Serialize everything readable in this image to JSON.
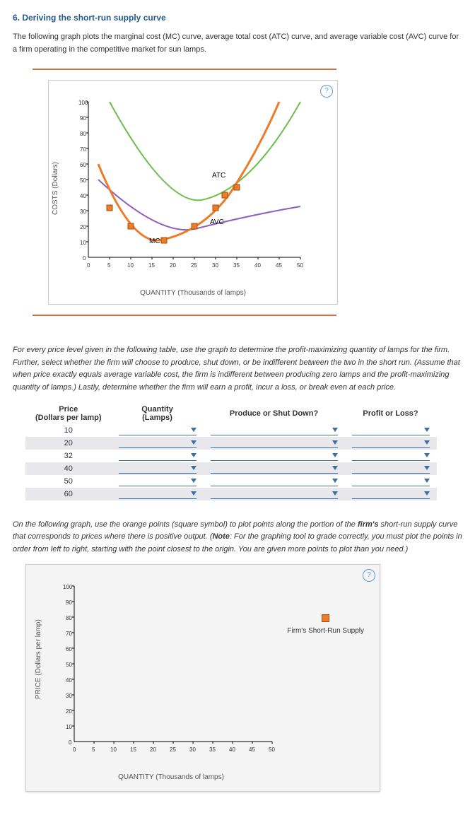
{
  "title": "6. Deriving the short-run supply curve",
  "intro": "The following graph plots the marginal cost (MC) curve, average total cost (ATC) curve, and average variable cost (AVC) curve for a firm operating in the competitive market for sun lamps.",
  "help": "?",
  "chart1": {
    "ylabel": "COSTS (Dollars)",
    "xlabel": "QUANTITY (Thousands of lamps)",
    "mc": "MC",
    "atc": "ATC",
    "avc": "AVC"
  },
  "instr2": "For every price level given in the following table, use the graph to determine the profit-maximizing quantity of lamps for the firm. Further, select whether the firm will choose to produce, shut down, or be indifferent between the two in the short run. (Assume that when price exactly equals average variable cost, the firm is indifferent between producing zero lamps and the profit-maximizing quantity of lamps.) Lastly, determine whether the firm will earn a profit, incur a loss, or break even at each price.",
  "table": {
    "h1a": "Price",
    "h1b": "(Dollars per lamp)",
    "h2a": "Quantity",
    "h2b": "(Lamps)",
    "h3": "Produce or Shut Down?",
    "h4": "Profit or Loss?",
    "prices": [
      "10",
      "20",
      "32",
      "40",
      "50",
      "60"
    ]
  },
  "instr3a": "On the following graph, use the orange points (square symbol) to plot points along the portion of the ",
  "instr3b": "firm's",
  "instr3c": " short-run supply curve that corresponds to prices where there is positive output. (",
  "instr3d": "Note",
  "instr3e": ": For the graphing tool to grade correctly, you must plot the points in order from left to right, starting with the point closest to the origin. You are given more points to plot than you need.)",
  "chart2": {
    "ylabel": "PRICE (Dollars per lamp)",
    "xlabel": "QUANTITY (Thousands of lamps)",
    "legend": "Firm's Short-Run Supply"
  },
  "chart_data": [
    {
      "type": "line",
      "title": "Cost curves",
      "xlabel": "QUANTITY (Thousands of lamps)",
      "ylabel": "COSTS (Dollars)",
      "xlim": [
        0,
        50
      ],
      "ylim": [
        0,
        100
      ],
      "xticks": [
        0,
        5,
        10,
        15,
        20,
        25,
        30,
        35,
        40,
        45,
        50
      ],
      "yticks": [
        0,
        10,
        20,
        30,
        40,
        50,
        60,
        70,
        80,
        90,
        100
      ],
      "series": [
        {
          "name": "MC",
          "color": "#ec7c2a",
          "x": [
            3,
            5,
            10,
            15,
            20,
            25,
            30,
            35,
            40,
            45
          ],
          "y": [
            60,
            32,
            20,
            12,
            14,
            20,
            32,
            45,
            60,
            100
          ]
        },
        {
          "name": "ATC",
          "color": "#6cbf4b",
          "x": [
            5,
            10,
            15,
            20,
            25,
            30,
            35,
            40,
            45,
            50
          ],
          "y": [
            100,
            65,
            48,
            40,
            37,
            40,
            47,
            55,
            72,
            100
          ]
        },
        {
          "name": "AVC",
          "color": "#8e5fbf",
          "x": [
            3,
            10,
            15,
            20,
            25,
            30,
            35,
            40,
            45,
            50
          ],
          "y": [
            50,
            30,
            22,
            18,
            18,
            20,
            25,
            30,
            32,
            33
          ]
        }
      ],
      "markers": {
        "name": "MC points",
        "color": "#ec7c2a",
        "shape": "square",
        "x": [
          5,
          10,
          25,
          30,
          32,
          35
        ],
        "y": [
          32,
          20,
          20,
          32,
          40,
          45
        ]
      }
    },
    {
      "type": "scatter",
      "title": "Firm's Short-Run Supply (to plot)",
      "xlabel": "QUANTITY (Thousands of lamps)",
      "ylabel": "PRICE (Dollars per lamp)",
      "xlim": [
        0,
        50
      ],
      "ylim": [
        0,
        100
      ],
      "xticks": [
        0,
        5,
        10,
        15,
        20,
        25,
        30,
        35,
        40,
        45,
        50
      ],
      "yticks": [
        0,
        10,
        20,
        30,
        40,
        50,
        60,
        70,
        80,
        90,
        100
      ],
      "legend": "Firm's Short-Run Supply"
    }
  ]
}
